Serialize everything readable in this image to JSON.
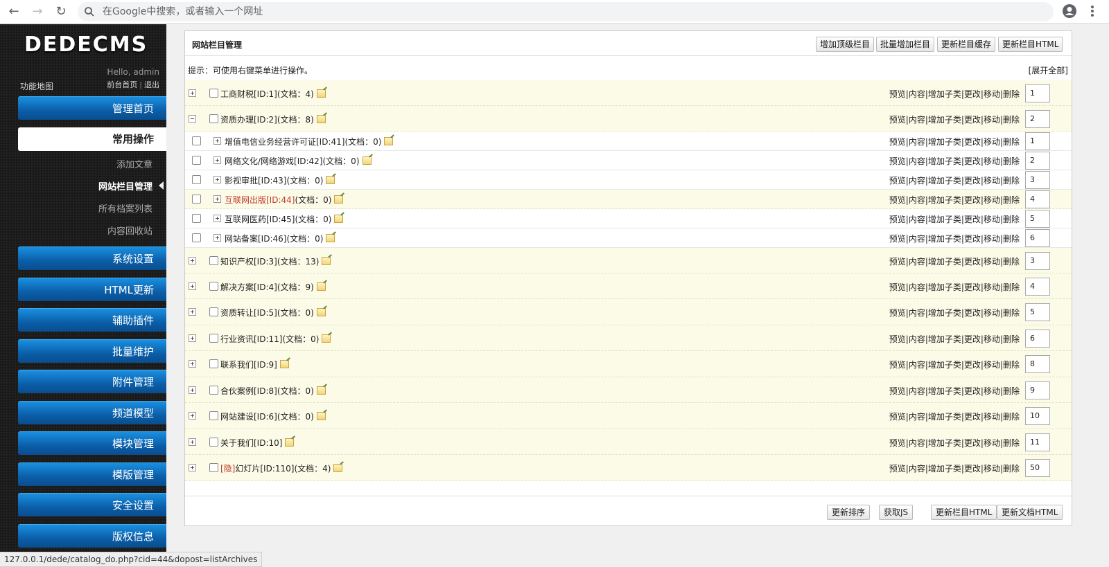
{
  "browser": {
    "omnibox_placeholder": "在Google中搜索，或者输入一个网址",
    "status_url": "127.0.0.1/dede/catalog_do.php?cid=44&dopost=listArchives"
  },
  "sidebar": {
    "logo": "DEDECMS",
    "hello": "Hello, admin",
    "sitemap": "功能地图",
    "front_home": "前台首页",
    "logout": "退出",
    "menus": [
      {
        "label": "管理首页"
      },
      {
        "label": "常用操作"
      },
      {
        "label": "系统设置"
      },
      {
        "label": "HTML更新"
      },
      {
        "label": "辅助插件"
      },
      {
        "label": "批量维护"
      },
      {
        "label": "附件管理"
      },
      {
        "label": "频道模型"
      },
      {
        "label": "模块管理"
      },
      {
        "label": "模版管理"
      },
      {
        "label": "安全设置"
      },
      {
        "label": "版权信息"
      }
    ],
    "subitems": [
      {
        "label": "添加文章"
      },
      {
        "label": "网站栏目管理"
      },
      {
        "label": "所有档案列表"
      },
      {
        "label": "内容回收站"
      }
    ]
  },
  "panel": {
    "title": "网站栏目管理",
    "buttons": [
      "增加顶级栏目",
      "批量增加栏目",
      "更新栏目缓存",
      "更新栏目HTML"
    ],
    "hint": "提示：可使用右键菜单进行操作。",
    "expand_all": "[展开全部]",
    "actions_text": "预览|内容|增加子类|更改|移动|删除",
    "rows": [
      {
        "label": "工商财税[ID:1](文档：4)",
        "order": "1"
      },
      {
        "label": "资质办理[ID:2](文档：8)",
        "order": "2"
      },
      {
        "label": "增值电信业务经营许可证[ID:41](文档：0)",
        "order": "1"
      },
      {
        "label": "网络文化/网络游戏[ID:42](文档：0)",
        "order": "2"
      },
      {
        "label": "影视审批[ID:43](文档：0)",
        "order": "3"
      },
      {
        "label_hl": "互联网出版[ID:44]",
        "label_rest": "(文档：0)",
        "order": "4"
      },
      {
        "label": "互联网医药[ID:45](文档：0)",
        "order": "5"
      },
      {
        "label": "网站备案[ID:46](文档：0)",
        "order": "6"
      },
      {
        "label": "知识产权[ID:3](文档：13)",
        "order": "3"
      },
      {
        "label": "解决方案[ID:4](文档：9)",
        "order": "4"
      },
      {
        "label": "资质转让[ID:5](文档：0)",
        "order": "5"
      },
      {
        "label": "行业资讯[ID:11](文档：0)",
        "order": "6"
      },
      {
        "label": "联系我们[ID:9]",
        "order": "8"
      },
      {
        "label": "合伙案例[ID:8](文档：0)",
        "order": "9"
      },
      {
        "label": "网站建设[ID:6](文档：0)",
        "order": "10"
      },
      {
        "label": "关于我们[ID:10]",
        "order": "11"
      },
      {
        "label_hl": "[隐]",
        "label_rest": "幻灯片[ID:110](文档：4)",
        "order": "50"
      }
    ],
    "bottom_buttons": [
      "更新排序",
      "获取JS",
      "更新栏目HTML",
      "更新文档HTML"
    ]
  }
}
